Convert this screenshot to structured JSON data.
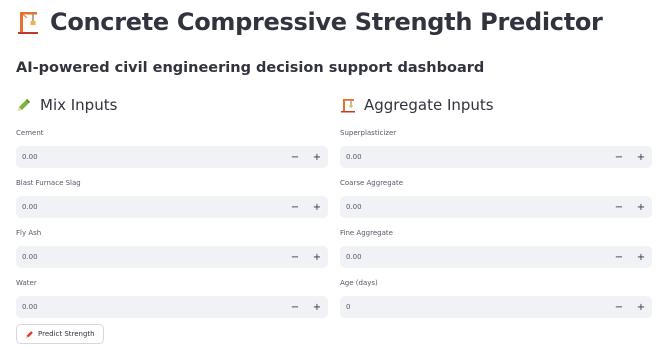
{
  "header": {
    "title": "Concrete Compressive Strength Predictor",
    "subtitle": "AI-powered civil engineering decision support dashboard",
    "icon": "construction-crane-icon"
  },
  "mix_inputs": {
    "heading": "Mix Inputs",
    "icon": "pencil-icon",
    "fields": [
      {
        "label": "Cement",
        "value": "0.00"
      },
      {
        "label": "Blast Furnace Slag",
        "value": "0.00"
      },
      {
        "label": "Fly Ash",
        "value": "0.00"
      },
      {
        "label": "Water",
        "value": "0.00"
      }
    ]
  },
  "aggregate_inputs": {
    "heading": "Aggregate Inputs",
    "icon": "construction-crane-icon",
    "fields": [
      {
        "label": "Superplasticizer",
        "value": "0.00"
      },
      {
        "label": "Coarse Aggregate",
        "value": "0.00"
      },
      {
        "label": "Fine Aggregate",
        "value": "0.00"
      },
      {
        "label": "Age (days)",
        "value": "0"
      }
    ]
  },
  "stepper": {
    "minus": "−",
    "plus": "+"
  },
  "predict_button": {
    "label": "Predict Strength",
    "icon": "pencil-icon"
  },
  "colors": {
    "text": "#31333f",
    "input_bg": "#f0f2f6",
    "crane_orange": "#e8702a",
    "pencil_green": "#7cb342"
  }
}
